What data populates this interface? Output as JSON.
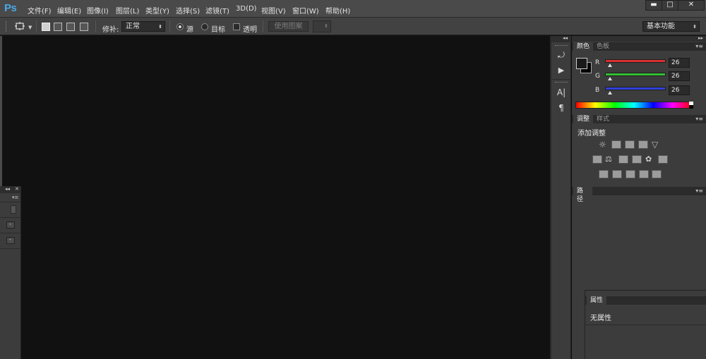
{
  "app": {
    "logo": "Ps",
    "accent_color": "#4aa8e8"
  },
  "menu": {
    "items": [
      "文件(F)",
      "编辑(E)",
      "图像(I)",
      "图层(L)",
      "类型(Y)",
      "选择(S)",
      "滤镜(T)",
      "3D(D)",
      "视图(V)",
      "窗口(W)",
      "帮助(H)"
    ]
  },
  "window_controls": {
    "minimize": "▬",
    "maximize": "□",
    "close": "✕"
  },
  "options_bar": {
    "tool_icon": "patch-tool-icon",
    "patch_label": "修补:",
    "patch_mode": "正常",
    "radio_source": "源",
    "radio_target": "目标",
    "transparent_label": "透明",
    "use_pattern_button": "使用图案",
    "workspace": "基本功能"
  },
  "color_panel": {
    "tabs": [
      "颜色",
      "色板"
    ],
    "channels": [
      {
        "label": "R",
        "value": "26",
        "color": "#d83030"
      },
      {
        "label": "G",
        "value": "26",
        "color": "#30c030"
      },
      {
        "label": "B",
        "value": "26",
        "color": "#3040d8"
      }
    ],
    "foreground": "#1a1a1a",
    "background": "#000000"
  },
  "adjustments_panel": {
    "tabs": [
      "调整",
      "样式"
    ],
    "title": "添加调整"
  },
  "paths_panel": {
    "tabs": [
      "路径"
    ]
  },
  "properties_panel": {
    "tabs": [
      "属性"
    ],
    "content": "无属性"
  },
  "dock": {
    "icons": [
      "history-icon",
      "actions-play-icon",
      "character-icon",
      "paragraph-icon"
    ],
    "character_glyph": "A|",
    "paragraph_glyph": "¶",
    "play_glyph": "▶",
    "history_glyph": "⤾"
  }
}
